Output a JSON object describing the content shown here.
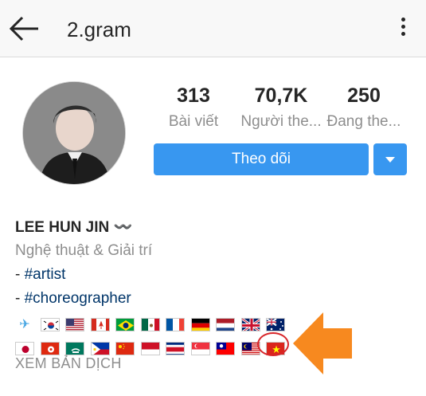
{
  "header": {
    "username": "2.gram"
  },
  "profile": {
    "stats": {
      "posts": {
        "value": "313",
        "label": "Bài viết"
      },
      "followers": {
        "value": "70,7K",
        "label": "Người the..."
      },
      "following": {
        "value": "250",
        "label": "Đang the..."
      }
    },
    "follow_label": "Theo dõi",
    "name": "LEE HUN JIN 〰️",
    "category": "Nghệ thuật & Giải trí",
    "bio_lines": [
      {
        "prefix": "- ",
        "tag": "#artist"
      },
      {
        "prefix": "- ",
        "tag": "#choreographer"
      }
    ],
    "flags_row1": [
      "airplane",
      "south-korea",
      "united-states",
      "canada",
      "brazil",
      "mexico",
      "france",
      "germany",
      "netherlands",
      "united-kingdom",
      "australia"
    ],
    "flags_row2": [
      "japan",
      "hong-kong",
      "macau",
      "philippines",
      "china",
      "indonesia",
      "costa-rica",
      "singapore",
      "taiwan",
      "malaysia",
      "vietnam"
    ],
    "translate_label": "XEM BẢN DỊCH"
  },
  "annotation": {
    "highlight_color": "#d8262a",
    "arrow_color": "#f7891f"
  },
  "colors": {
    "accent": "#3897f0",
    "hashtag": "#003569",
    "secondary_text": "#8e8e8e"
  }
}
